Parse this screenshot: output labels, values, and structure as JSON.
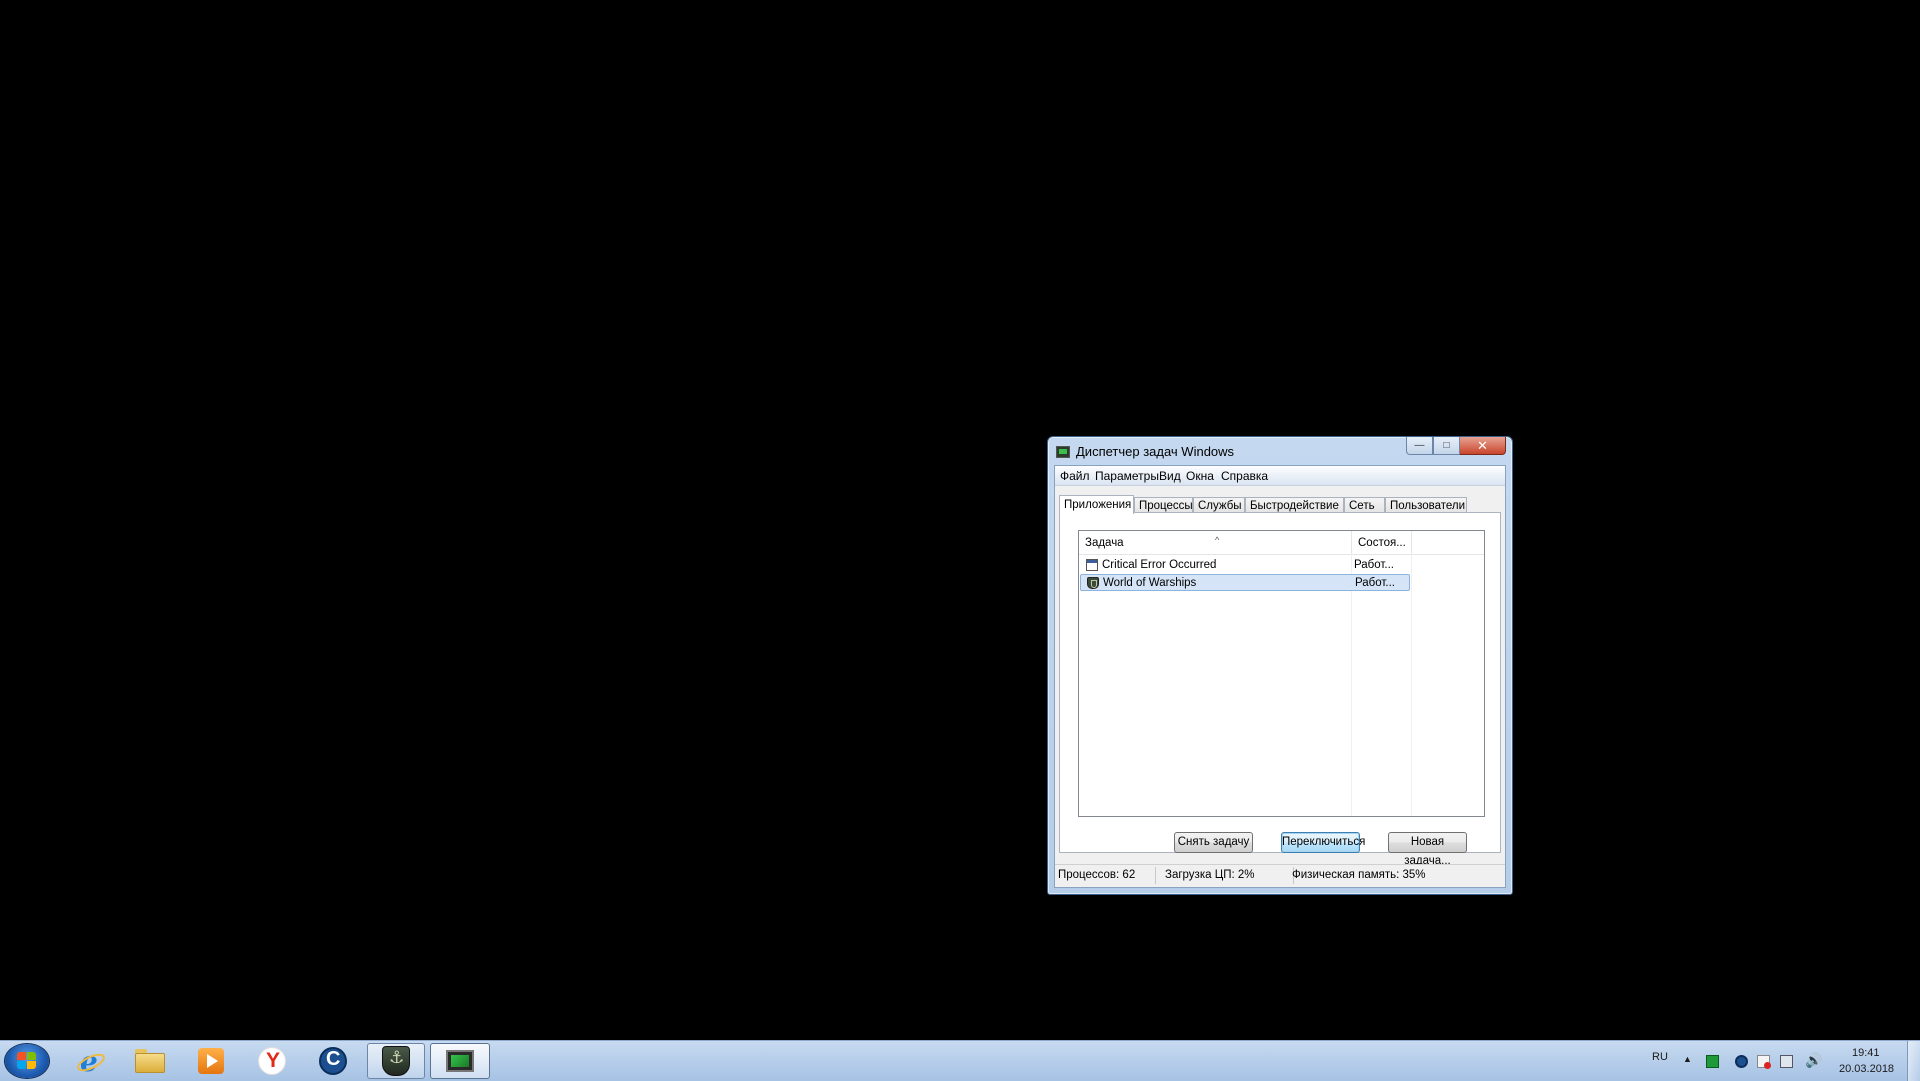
{
  "window": {
    "title": "Диспетчер задач Windows",
    "menu": [
      "Файл",
      "Параметры",
      "Вид",
      "Окна",
      "Справка"
    ],
    "tabs": [
      "Приложения",
      "Процессы",
      "Службы",
      "Быстродействие",
      "Сеть",
      "Пользователи"
    ],
    "active_tab": "Приложения",
    "columns": {
      "task": "Задача",
      "status": "Состоя..."
    },
    "tasks": [
      {
        "name": "Critical Error Occurred",
        "status": "Работ...",
        "icon": "window-icon",
        "selected": false
      },
      {
        "name": "World of Warships",
        "status": "Работ...",
        "icon": "world-of-warships-icon",
        "selected": true
      }
    ],
    "buttons": {
      "end_task": "Снять задачу",
      "switch_to": "Переключиться",
      "new_task": "Новая задача..."
    },
    "status": {
      "processes": "Процессов: 62",
      "cpu": "Загрузка ЦП: 2%",
      "memory": "Физическая память: 35%"
    }
  },
  "taskbar": {
    "pinned": [
      "start-orb",
      "internet-explorer-icon",
      "folder-icon",
      "media-player-icon",
      "yandex-browser-icon",
      "ccleaner-icon",
      "world-of-warships-icon",
      "task-manager-icon"
    ],
    "language": "RU",
    "time": "19:41",
    "date": "20.03.2018"
  },
  "colors": {
    "desktop": "#000000",
    "taskbar": "#b9d1ee",
    "selection": "#d5e5f7"
  }
}
